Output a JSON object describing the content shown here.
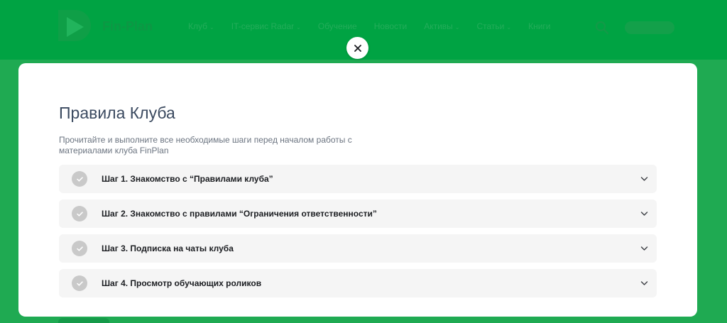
{
  "header": {
    "logo_text": "Fin-Plan",
    "nav": [
      {
        "label": "Клуб",
        "has_caret": true
      },
      {
        "label": "IT-сервис Radar",
        "has_caret": true
      },
      {
        "label": "Обучение",
        "has_caret": false
      },
      {
        "label": "Новости",
        "has_caret": false
      },
      {
        "label": "Активы",
        "has_caret": true
      },
      {
        "label": "Статьи",
        "has_caret": true
      },
      {
        "label": "Книги",
        "has_caret": false
      }
    ],
    "caret_glyph": "⌄",
    "brand_color": "#00a343"
  },
  "modal": {
    "close_glyph": "✕",
    "title": "Правила Клуба",
    "subtitle": "Прочитайте и выполните все необходимые шаги перед началом работы с материалами клуба FinPlan",
    "steps": [
      {
        "label": "Шаг 1. Знакомство с “Правилами клуба”",
        "completed": false
      },
      {
        "label": "Шаг 2. Знакомство с правилами “Ограничения ответственности”",
        "completed": false
      },
      {
        "label": "Шаг 3. Подписка на чаты клуба",
        "completed": false
      },
      {
        "label": "Шаг 4. Просмотр обучающих роликов",
        "completed": false
      }
    ],
    "check_color": "#c9c9c9",
    "step_bg": "#f5f5f5"
  }
}
